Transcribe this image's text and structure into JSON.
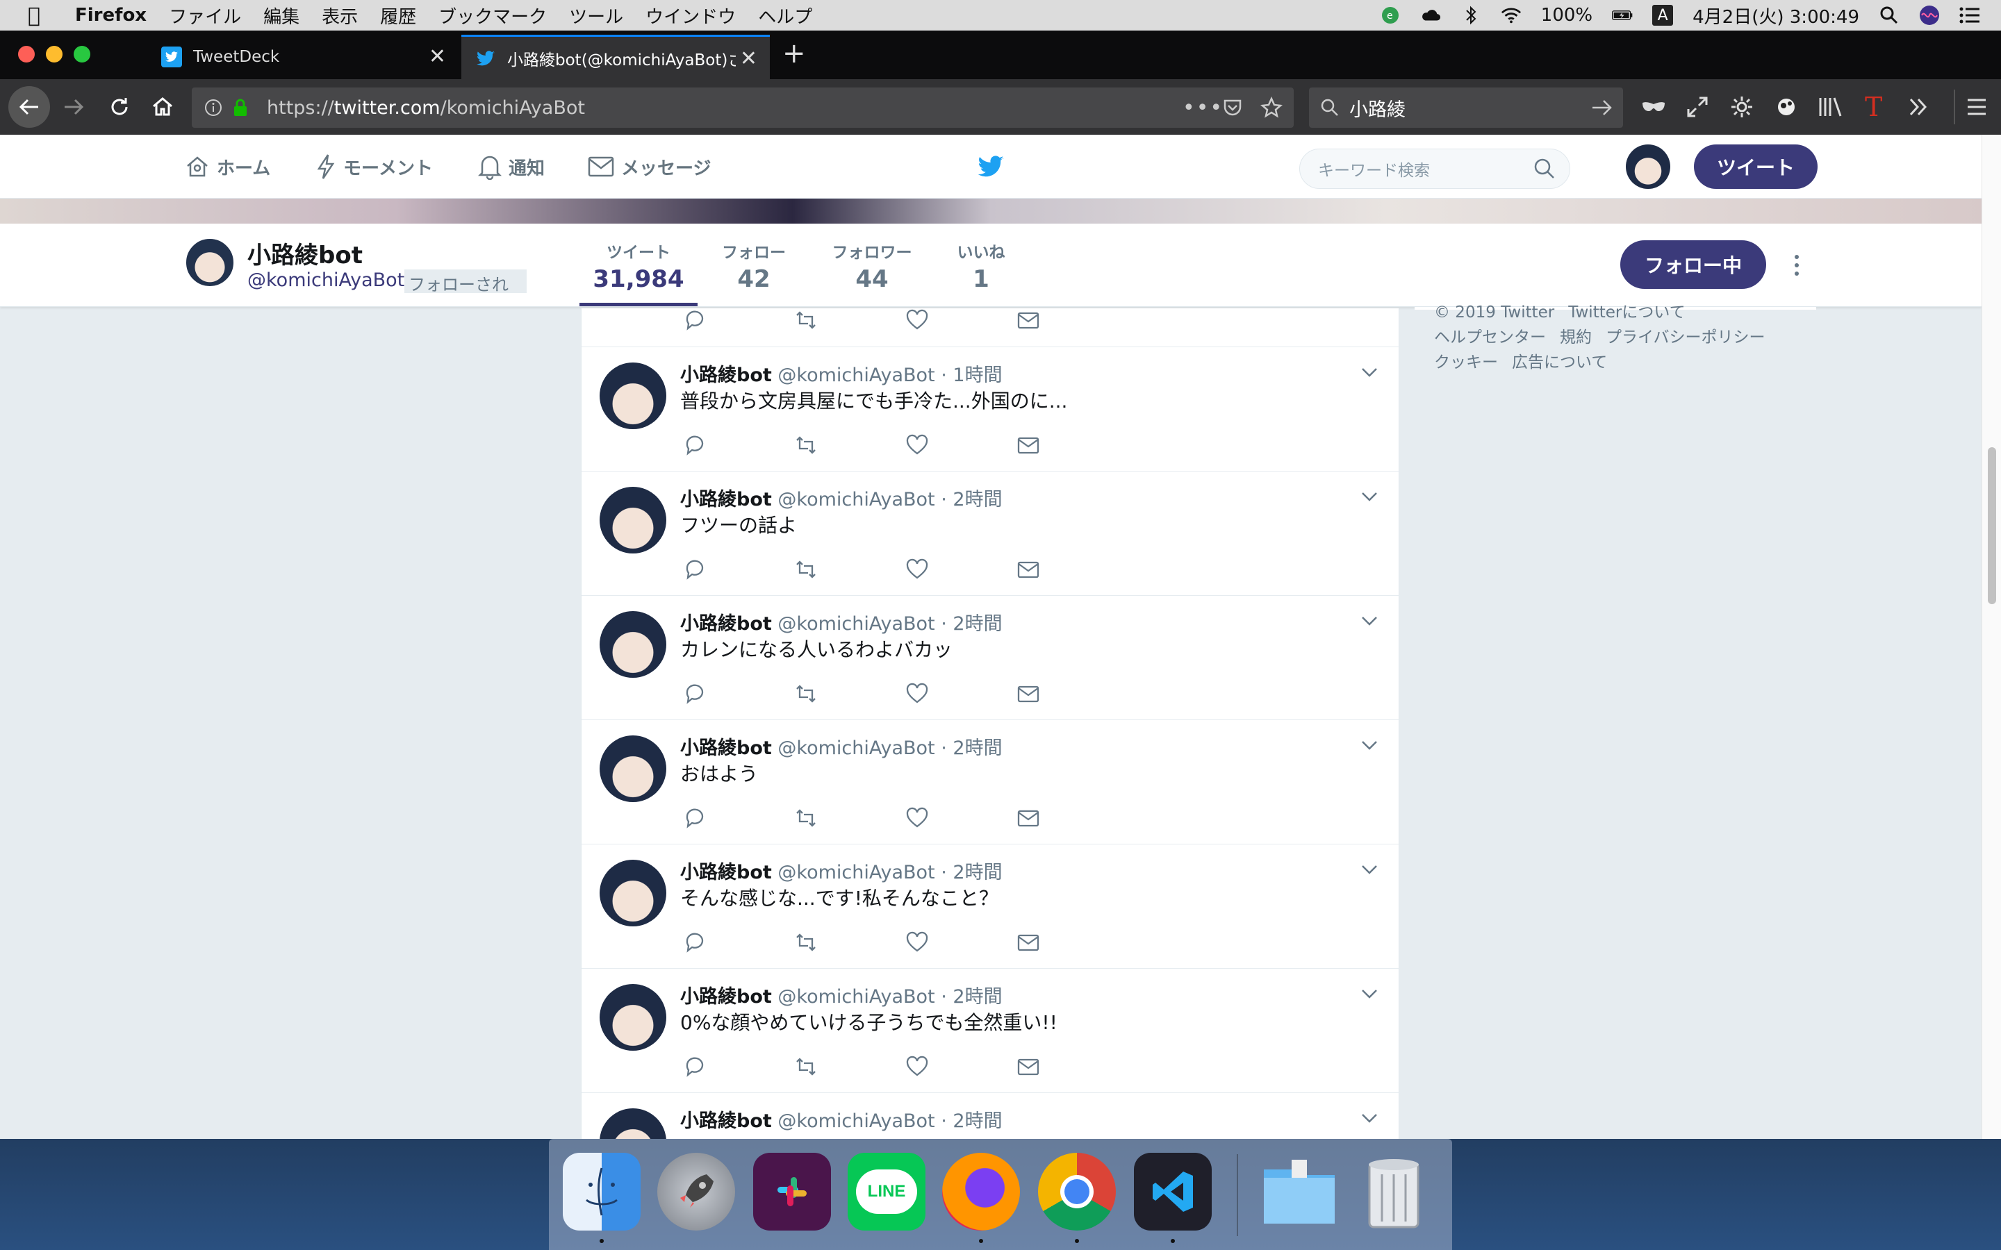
{
  "menubar": {
    "app_name": "Firefox",
    "items": [
      "ファイル",
      "編集",
      "表示",
      "履歴",
      "ブックマーク",
      "ツール",
      "ウインドウ",
      "ヘルプ"
    ],
    "battery": "100%",
    "input_mode": "A",
    "datetime": "4月2日(火) 3:00:49"
  },
  "browser": {
    "tabs": [
      {
        "title": "TweetDeck"
      },
      {
        "title": "小路綾bot(@komichiAyaBot)さん"
      }
    ],
    "url_prefix": "https://",
    "url_host": "twitter.com",
    "url_path": "/komichiAyaBot",
    "search_value": "小路綾"
  },
  "twitter_nav": {
    "home": "ホーム",
    "moments": "モーメント",
    "notifications": "通知",
    "messages": "メッセージ",
    "search_placeholder": "キーワード検索",
    "tweet_button": "ツイート"
  },
  "profile": {
    "name": "小路綾bot",
    "handle": "@komichiAyaBot",
    "follows_you": "フォローされています",
    "stats": [
      {
        "label": "ツイート",
        "value": "31,984"
      },
      {
        "label": "フォロー",
        "value": "42"
      },
      {
        "label": "フォロワー",
        "value": "44"
      },
      {
        "label": "いいね",
        "value": "1"
      }
    ],
    "following_button": "フォロー中"
  },
  "tweets": [
    {
      "name": "小路綾bot",
      "handle": "@komichiAyaBot",
      "time": "· 1時間",
      "text": "普段から文房具屋にでも手冷た...外国のに..."
    },
    {
      "name": "小路綾bot",
      "handle": "@komichiAyaBot",
      "time": "· 2時間",
      "text": "フツーの話よ"
    },
    {
      "name": "小路綾bot",
      "handle": "@komichiAyaBot",
      "time": "· 2時間",
      "text": "カレンになる人いるわよバカッ"
    },
    {
      "name": "小路綾bot",
      "handle": "@komichiAyaBot",
      "time": "· 2時間",
      "text": "おはよう"
    },
    {
      "name": "小路綾bot",
      "handle": "@komichiAyaBot",
      "time": "· 2時間",
      "text": "そんな感じな...です!私そんなこと？"
    },
    {
      "name": "小路綾bot",
      "handle": "@komichiAyaBot",
      "time": "· 2時間",
      "text": "0%な顔やめていける子うちでも全然重い!!"
    },
    {
      "name": "小路綾bot",
      "handle": "@komichiAyaBot",
      "time": "· 2時間",
      "text": ""
    }
  ],
  "footer": {
    "copyright": "© 2019 Twitter",
    "about": "Twitterについて",
    "help": "ヘルプセンター",
    "terms": "規約",
    "privacy": "プライバシーポリシー",
    "cookies": "クッキー",
    "ads": "広告について"
  },
  "dock": {
    "apps": [
      "finder-icon",
      "launchpad-icon",
      "slack-icon",
      "line-icon",
      "firefox-icon",
      "chrome-icon",
      "vscode-icon",
      "downloads-folder-icon",
      "trash-icon"
    ],
    "line_label": "LINE"
  },
  "colors": {
    "twitter_blue": "#1da1f2",
    "brand_purple": "#3b3a7a",
    "firefox_tab_accent": "#0a84ff"
  }
}
